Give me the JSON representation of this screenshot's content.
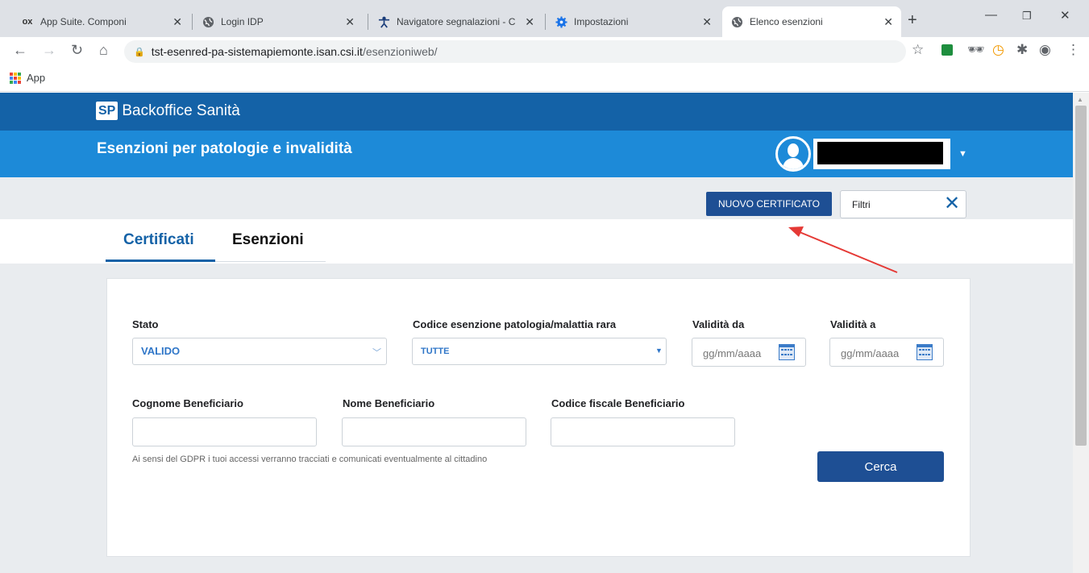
{
  "browser": {
    "tabs": [
      {
        "icon": "ox-logo",
        "title": "App Suite. Componi"
      },
      {
        "icon": "globe-icon",
        "title": "Login IDP"
      },
      {
        "icon": "person-icon",
        "title": "Navigatore segnalazioni - C"
      },
      {
        "icon": "gear-icon",
        "title": "Impostazioni"
      },
      {
        "icon": "globe-icon",
        "title": "Elenco esenzioni"
      }
    ],
    "ox_logo_text": "ox",
    "url_host": "tst-esenred-pa-sistemapiemonte.isan.csi.it",
    "url_path": "/esenzioniweb/",
    "bookmark_apps": "App"
  },
  "header": {
    "brand_logo": "SP",
    "brand_name": "Backoffice Sanità",
    "app_title": "Esenzioni per patologie e invalidità"
  },
  "actions": {
    "new_certificate": "NUOVO CERTIFICATO",
    "filters_label": "Filtri"
  },
  "tabs": {
    "certificati": "Certificati",
    "esenzioni": "Esenzioni"
  },
  "form": {
    "stato_label": "Stato",
    "stato_value": "VALIDO",
    "codice_label": "Codice esenzione patologia/malattia rara",
    "codice_value": "TUTTE",
    "validita_da_label": "Validità da",
    "validita_a_label": "Validità a",
    "date_placeholder": "gg/mm/aaaa",
    "cognome_label": "Cognome Beneficiario",
    "nome_label": "Nome Beneficiario",
    "cf_label": "Codice fiscale Beneficiario",
    "gdpr_note": "Ai sensi del GDPR i tuoi accessi verranno tracciati e comunicati eventualmente al cittadino",
    "search_button": "Cerca"
  },
  "colors": {
    "brand_dark": "#1462a7",
    "brand_light": "#1d8ad8",
    "button": "#1e4f94",
    "annotation_arrow": "#e53935"
  }
}
